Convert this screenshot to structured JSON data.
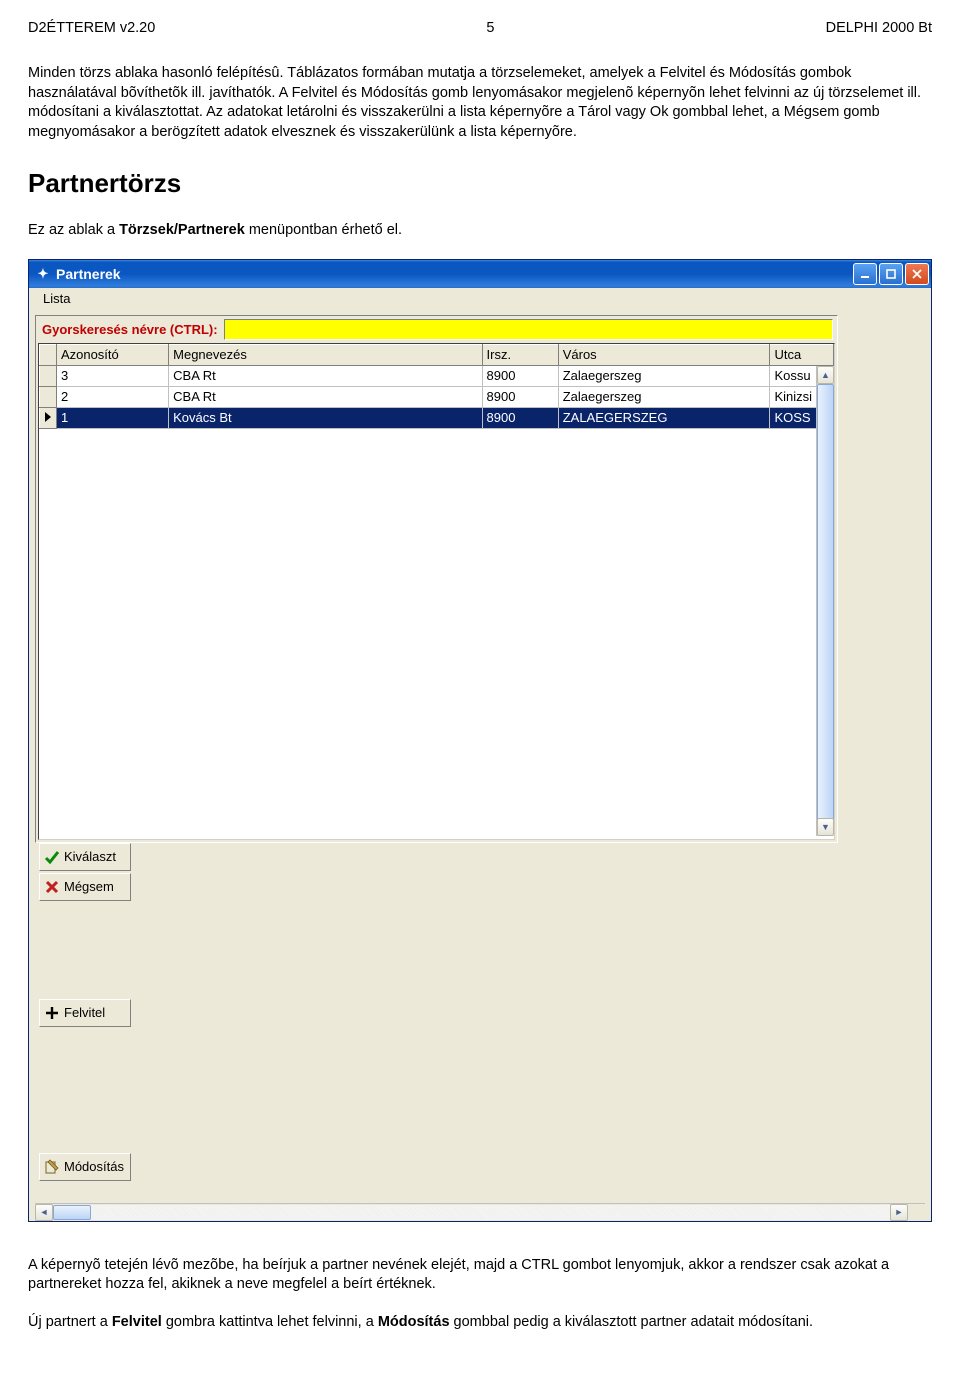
{
  "header": {
    "left": "D2ÉTTEREM v2.20",
    "page": "5",
    "right": "DELPHI 2000 Bt"
  },
  "para1_a": "Minden törzs ablaka hasonló felépítésû. Táblázatos formában mutatja a törzselemeket, amelyek a Felvitel és Módosítás gombok használatával bõvíthetõk ill. javíthatók. A Felvitel és Módosítás gomb lenyomásakor megjelenõ képernyõn lehet felvinni az új törzselemet ill. módosítani a kiválasztottat. Az adatokat letárolni és visszakerülni a lista képernyõre a Tárol vagy Ok gombbal lehet, a Mégsem gomb megnyomásakor a berögzített adatok elvesznek és visszakerülünk a lista képernyõre.",
  "h2": "Partnertörzs",
  "para2_a": "Ez az ablak a ",
  "para2_b": "Törzsek/Partnerek",
  "para2_c": " menüpontban érhető el.",
  "window": {
    "title": "Partnerek",
    "menu": {
      "lista": "Lista"
    },
    "search": {
      "label": "Gyorskeresés névre (CTRL):",
      "value": ""
    },
    "columns": {
      "id": "Azonosító",
      "name": "Megnevezés",
      "zip": "Irsz.",
      "city": "Város",
      "street": "Utca"
    },
    "rows": [
      {
        "id": "3",
        "name": "CBA Rt",
        "zip": "8900",
        "city": "Zalaegerszeg",
        "street": "Kossu",
        "selected": false
      },
      {
        "id": "2",
        "name": "CBA Rt",
        "zip": "8900",
        "city": "Zalaegerszeg",
        "street": "Kinizsi",
        "selected": false
      },
      {
        "id": "1",
        "name": "Kovács Bt",
        "zip": "8900",
        "city": "ZALAEGERSZEG",
        "street": "KOSS",
        "selected": true
      }
    ],
    "buttons": {
      "select": "Kiválaszt",
      "cancel": "Mégsem",
      "add": "Felvitel",
      "edit": "Módosítás"
    }
  },
  "para3": "A képernyõ tetején lévõ mezõbe, ha beírjuk a partner nevének elejét, majd a CTRL gombot lenyomjuk, akkor a rendszer csak azokat a partnereket hozza fel, akiknek a neve megfelel a beírt értéknek.",
  "para4_a": "Új partnert a ",
  "para4_b": "Felvitel",
  "para4_c": " gombra kattintva lehet felvinni, a ",
  "para4_d": "Módosítás",
  "para4_e": " gombbal pedig a kiválasztott partner adatait módosítani."
}
